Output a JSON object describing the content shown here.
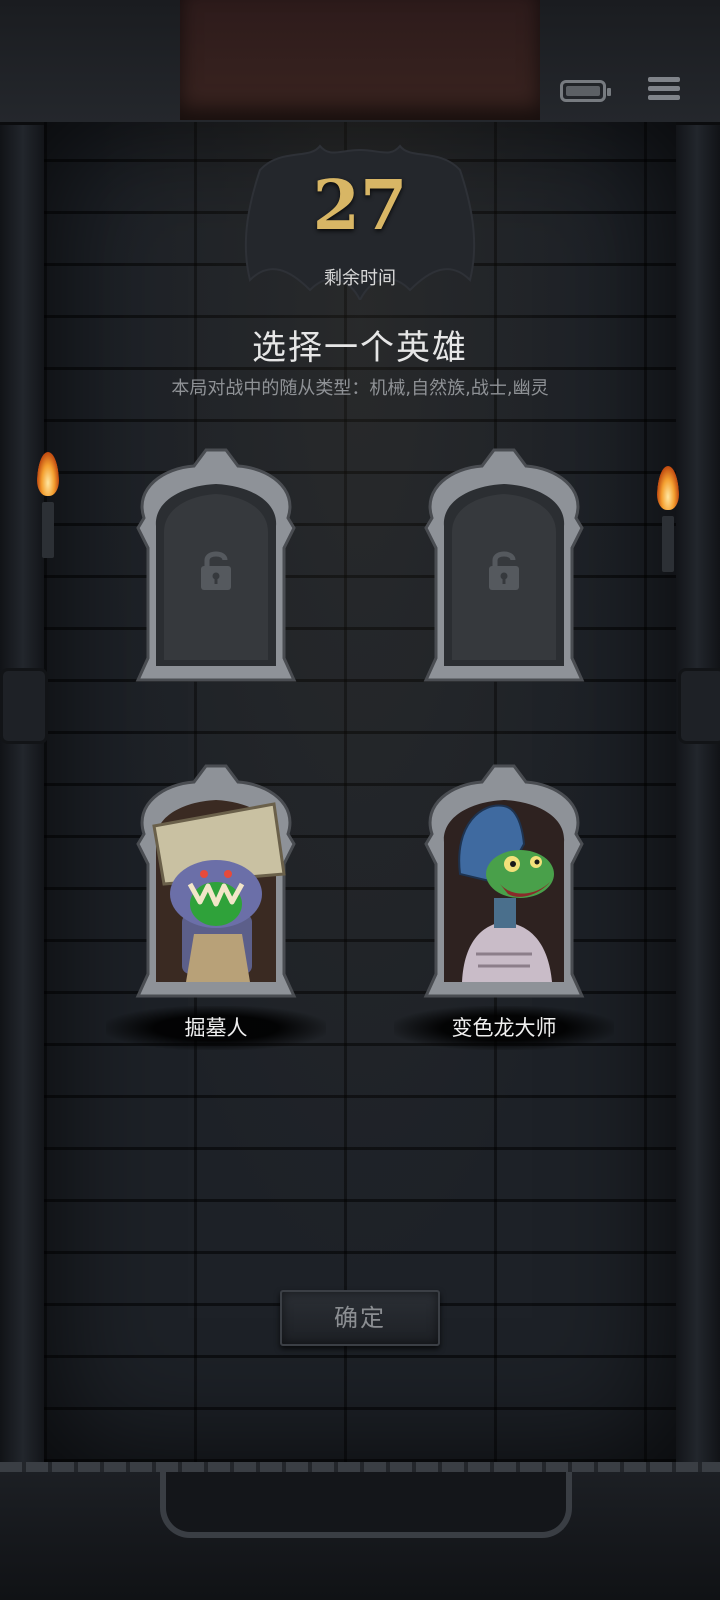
{
  "timer": {
    "value": "27",
    "label": "剩余时间"
  },
  "title": "选择一个英雄",
  "subtitle": "本局对战中的随从类型：机械,自然族,战士,幽灵",
  "hero_slots": [
    {
      "state": "locked",
      "icon": "lock-icon"
    },
    {
      "state": "locked",
      "icon": "lock-icon"
    },
    {
      "state": "available",
      "name": "掘墓人",
      "portrait": "gravedigger-portrait"
    },
    {
      "state": "available",
      "name": "变色龙大师",
      "portrait": "chameleon-master-portrait"
    }
  ],
  "confirm_button": {
    "label": "确定"
  },
  "status_icons": [
    "battery-icon",
    "menu-icon"
  ],
  "colors": {
    "timer_gold": "#d8b665",
    "title_text": "#e6e6e6",
    "subtitle_text": "#8f9296",
    "wall": "#1d2127",
    "frame_silver": "#9a9ea4"
  }
}
